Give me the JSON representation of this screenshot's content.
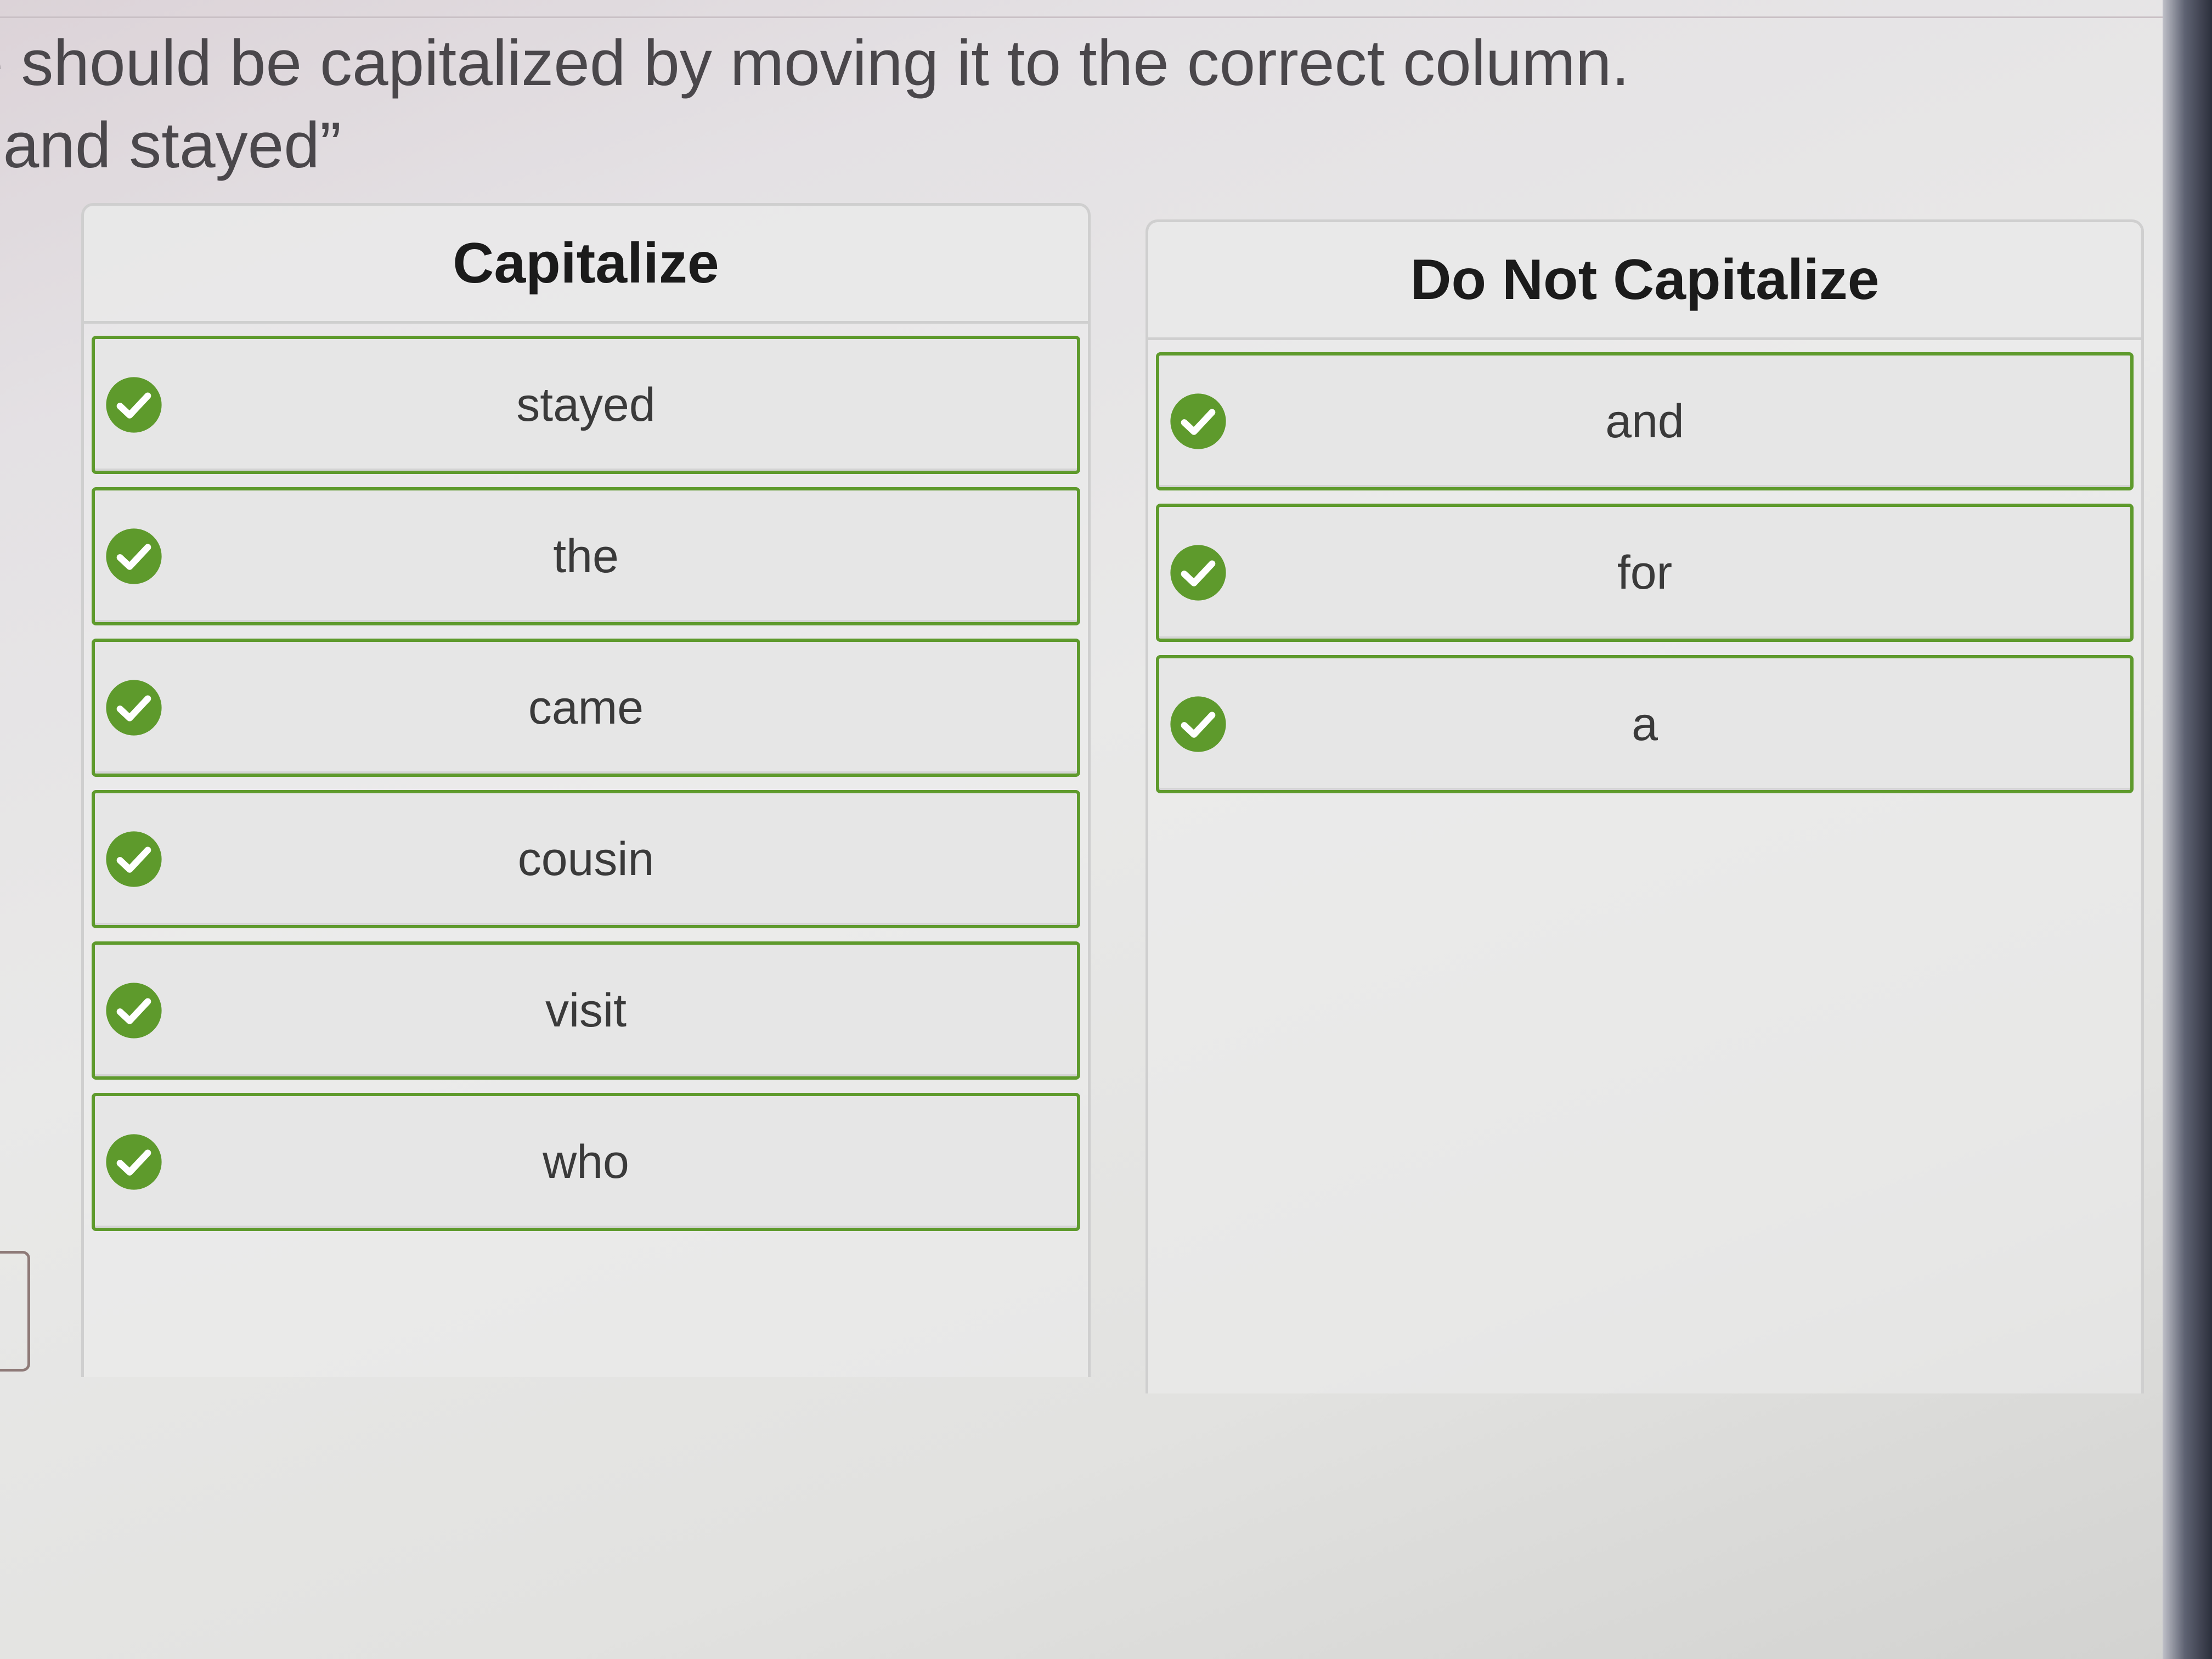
{
  "instructions": {
    "line1": "e should be capitalized by moving it to the correct column.",
    "line2": "t and stayed”"
  },
  "columns": [
    {
      "title": "Capitalize",
      "items": [
        {
          "word": "stayed",
          "status_icon": "check-circle-icon"
        },
        {
          "word": "the",
          "status_icon": "check-circle-icon"
        },
        {
          "word": "came",
          "status_icon": "check-circle-icon"
        },
        {
          "word": "cousin",
          "status_icon": "check-circle-icon"
        },
        {
          "word": "visit",
          "status_icon": "check-circle-icon"
        },
        {
          "word": "who",
          "status_icon": "check-circle-icon"
        }
      ]
    },
    {
      "title": "Do Not Capitalize",
      "items": [
        {
          "word": "and",
          "status_icon": "check-circle-icon"
        },
        {
          "word": "for",
          "status_icon": "check-circle-icon"
        },
        {
          "word": "a",
          "status_icon": "check-circle-icon"
        }
      ]
    }
  ],
  "colors": {
    "correct_green": "#5e9a2c",
    "tile_background": "#e6e6e6",
    "header_text": "#1b1b1b"
  }
}
